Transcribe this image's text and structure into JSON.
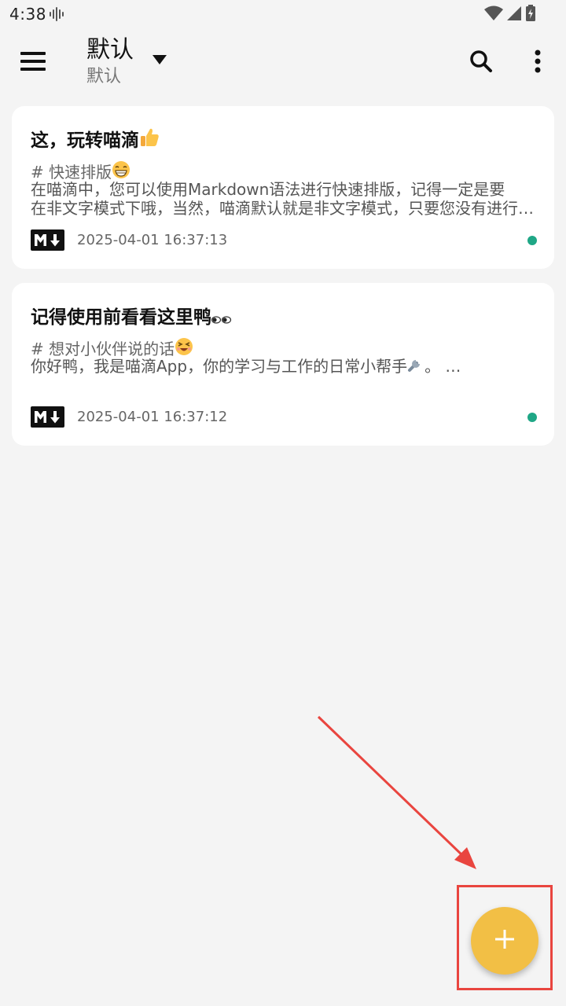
{
  "status_bar": {
    "time": "4:38"
  },
  "app_bar": {
    "title": "默认",
    "subtitle": "默认"
  },
  "notes": [
    {
      "title": "这，玩转喵滴",
      "tag": "# 快速排版",
      "body_lines": [
        "在喵滴中，您可以使用Markdown语法进行快速排版，记得一定是要",
        "在非文字模式下哦，当然，喵滴默认就是非文字模式，只要您没有进行过修改的话"
      ],
      "date": "2025-04-01 16:37:13",
      "title_emoji": "thumbs-up-icon",
      "tag_emoji": "grinning-face-icon"
    },
    {
      "title": "记得使用前看看这里鸭",
      "tag": "# 想对小伙伴说的话",
      "body_lines": [
        "",
        "你好鸭，我是喵滴App，你的学习与工作的日常小帮手"
      ],
      "body_suffix": "。 …",
      "date": "2025-04-01 16:37:12",
      "title_emoji": "eyes-icon",
      "tag_emoji": "squinting-face-icon"
    }
  ],
  "colors": {
    "background": "#f4f4f4",
    "card": "#ffffff",
    "fab": "#f2bf45",
    "sync_dot": "#1fa786",
    "annotation": "#e9453f"
  },
  "icons": {
    "menu": "menu-icon",
    "dropdown": "dropdown-triangle-icon",
    "search": "search-icon",
    "more": "more-vert-icon",
    "markdown": "markdown-icon",
    "fab": "plus-icon"
  }
}
